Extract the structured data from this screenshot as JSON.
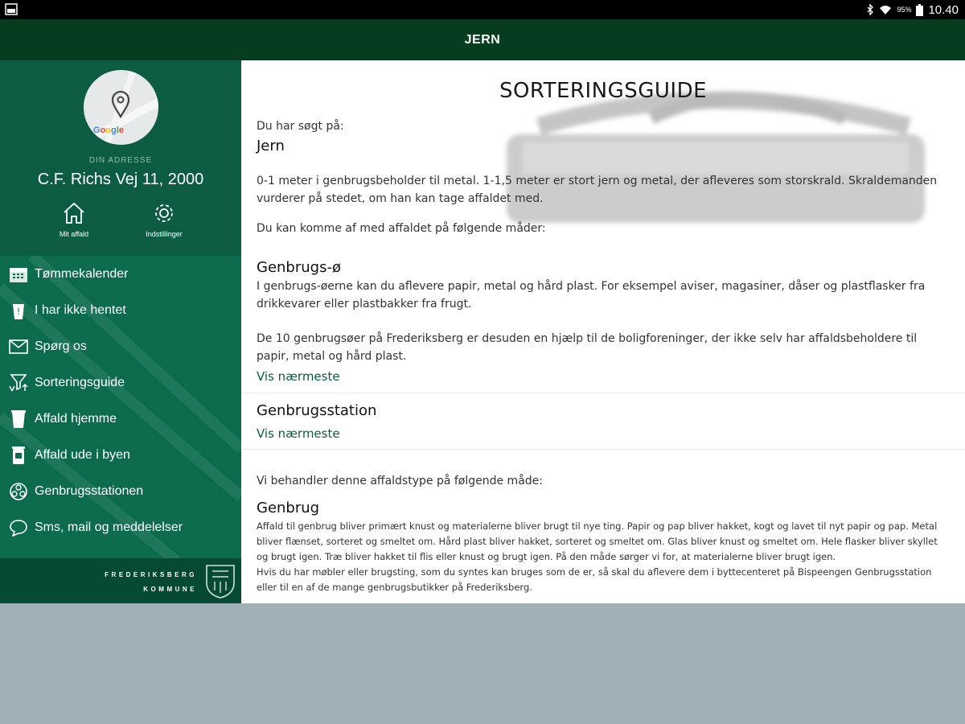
{
  "status_bar": {
    "battery_text": "95%",
    "time": "10.40"
  },
  "app_bar": {
    "title": "JERN"
  },
  "drawer": {
    "map_attribution": "Google",
    "address_label": "DIN ADRESSE",
    "address": "C.F. Richs Vej 11, 2000",
    "header_buttons": [
      {
        "label": "Mit affald",
        "icon": "home-icon"
      },
      {
        "label": "Indstillinger",
        "icon": "gear-icon"
      }
    ],
    "menu": [
      {
        "label": "Tømmekalender",
        "icon": "calendar-icon"
      },
      {
        "label": "I har ikke hentet",
        "icon": "bin-alert-icon"
      },
      {
        "label": "Spørg os",
        "icon": "mail-icon"
      },
      {
        "label": "Sorteringsguide",
        "icon": "sorting-icon"
      },
      {
        "label": "Affald hjemme",
        "icon": "bin-icon"
      },
      {
        "label": "Affald ude i byen",
        "icon": "street-bin-icon"
      },
      {
        "label": "Genbrugsstationen",
        "icon": "recycle-icon"
      },
      {
        "label": "Sms, mail og meddelelser",
        "icon": "chat-icon"
      }
    ],
    "footer": {
      "line1": "FREDERIKSBERG",
      "line2": "KOMMUNE"
    }
  },
  "content": {
    "title": "SORTERINGSGUIDE",
    "search_label": "Du har søgt på:",
    "search_value": "Jern",
    "description": "0-1 meter i genbrugsbeholder til metal. 1-1,5 meter er stort jern og metal, der afleveres som storskrald. Skraldemanden vurderer på stedet, om han kan tage affaldet med.",
    "ways_intro": "Du kan komme af med affaldet på følgende måder:",
    "genbrugs_o": {
      "title": "Genbrugs-ø",
      "p1": "I genbrugs-øerne kan du aflevere papir, metal og hård plast. For eksempel aviser, magasiner, dåser og plastflasker fra drikkevarer eller plastbakker fra frugt.",
      "p2": "De 10 genbrugsøer på Frederiksberg er desuden en hjælp til de boligforeninger, der ikke selv har affaldsbeholdere til papir, metal og hård plast.",
      "link": "Vis nærmeste"
    },
    "station": {
      "title": "Genbrugsstation",
      "link": "Vis nærmeste"
    },
    "treatment_intro": "Vi behandler denne affaldstype på følgende måde:",
    "genbrug": {
      "title": "Genbrug",
      "p1": "Affald til genbrug bliver primært knust og materialerne bliver brugt til nye ting. Papir og pap bliver hakket, kogt og lavet til nyt papir og pap. Metal bliver flænset, sorteret og smeltet om. Hård plast bliver hakket, sorteret og smeltet om. Glas bliver knust og smeltet om. Hele flasker bliver skyllet og brugt igen. Træ bliver hakket til flis eller knust og brugt igen. På den måde sørger vi for, at materialerne bliver brugt igen.",
      "p2": "Hvis du har møbler eller brugsting, som du syntes kan bruges som de er, så skal du aflevere dem i byttecenteret på Bispeengen Genbrugsstation eller til en af de mange genbrugsbutikker på Frederiksberg."
    }
  },
  "colors": {
    "app_bar": "#063d1f",
    "drawer": "#0c6b4d",
    "drawer_header": "#0b5c43",
    "link": "#0b5c43",
    "below_screen": "#a1b0b6"
  }
}
